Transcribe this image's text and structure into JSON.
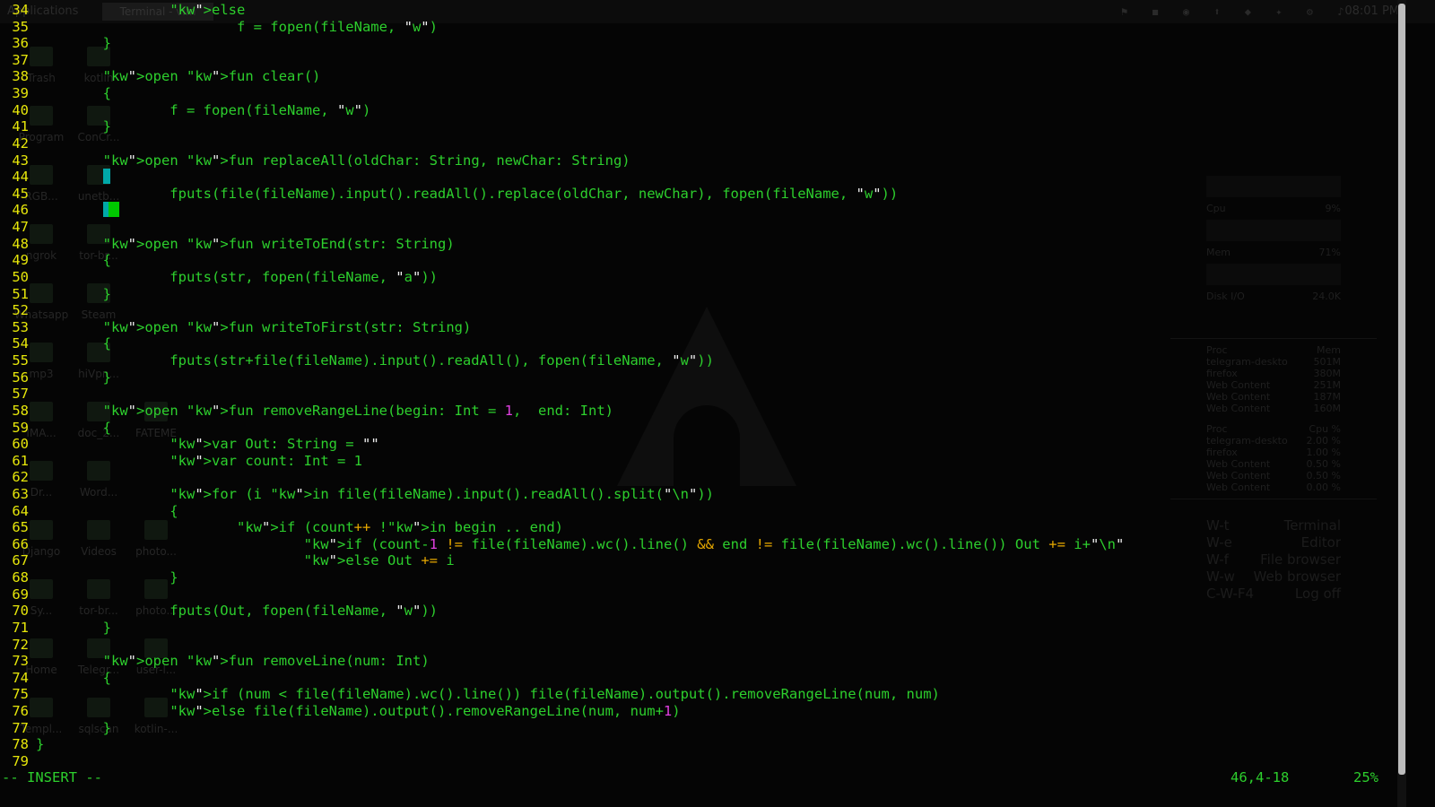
{
  "desktop": {
    "topbar": {
      "apps_menu": "Applications",
      "window_button": "Terminal - vim",
      "clock": "08:01 PM"
    },
    "icons": [
      {
        "label": "Trash"
      },
      {
        "label": "kotlin"
      },
      {
        "label": "Program"
      },
      {
        "label": "ConCr..."
      },
      {
        "label": "RGB..."
      },
      {
        "label": "unetb..."
      },
      {
        "label": "ngrok"
      },
      {
        "label": "tor-br..."
      },
      {
        "label": "Whatsapp"
      },
      {
        "label": "Steam"
      },
      {
        "label": "mp3"
      },
      {
        "label": "hiVpn..."
      },
      {
        "label": "IMA..."
      },
      {
        "label": "doc_2..."
      },
      {
        "label": "FATEME"
      },
      {
        "label": "Dr..."
      },
      {
        "label": "Word..."
      },
      {
        "label": "Django"
      },
      {
        "label": "Videos"
      },
      {
        "label": "photo..."
      },
      {
        "label": "Sy..."
      },
      {
        "label": "tor-br..."
      },
      {
        "label": "photo..."
      },
      {
        "label": "Home"
      },
      {
        "label": "Telegr..."
      },
      {
        "label": "user-l..."
      },
      {
        "label": "Templ..."
      },
      {
        "label": "sqlscan"
      },
      {
        "label": "kotlin-..."
      }
    ],
    "conky": {
      "cpu_label": "Cpu",
      "cpu_value": "9%",
      "mem_label": "Mem",
      "mem_value": "71%",
      "disk_label": "Disk I/O",
      "disk_value": "24.0K",
      "proc_mem_header": [
        "Proc",
        "Mem"
      ],
      "proc_mem": [
        [
          "telegram-deskto",
          "501M"
        ],
        [
          "firefox",
          "380M"
        ],
        [
          "Web Content",
          "251M"
        ],
        [
          "Web Content",
          "187M"
        ],
        [
          "Web Content",
          "160M"
        ]
      ],
      "proc_cpu_header": [
        "Proc",
        "Cpu %"
      ],
      "proc_cpu": [
        [
          "telegram-deskto",
          "2.00 %"
        ],
        [
          "firefox",
          "1.00 %"
        ],
        [
          "Web Content",
          "0.50 %"
        ],
        [
          "Web Content",
          "0.50 %"
        ],
        [
          "Web Content",
          "0.00 %"
        ]
      ],
      "shortcuts": [
        [
          "W-t",
          "Terminal"
        ],
        [
          "W-e",
          "Editor"
        ],
        [
          "W-f",
          "File browser"
        ],
        [
          "W-w",
          "Web browser"
        ],
        [
          "C-W-F4",
          "Log off"
        ]
      ]
    }
  },
  "editor": {
    "lines": [
      {
        "n": "34",
        "t": "                else"
      },
      {
        "n": "35",
        "t": "                        f = fopen(fileName, \"w\")"
      },
      {
        "n": "36",
        "t": "        }"
      },
      {
        "n": "37",
        "t": ""
      },
      {
        "n": "38",
        "t": "        open fun clear()"
      },
      {
        "n": "39",
        "t": "        {"
      },
      {
        "n": "40",
        "t": "                f = fopen(fileName, \"w\")"
      },
      {
        "n": "41",
        "t": "        }"
      },
      {
        "n": "42",
        "t": ""
      },
      {
        "n": "43",
        "t": "        open fun replaceAll(oldChar: String, newChar: String)"
      },
      {
        "n": "44",
        "t": ""
      },
      {
        "n": "45",
        "t": "                fputs(file(fileName).input().readAll().replace(oldChar, newChar), fopen(fileName, \"w\"))"
      },
      {
        "n": "46",
        "t": ""
      },
      {
        "n": "47",
        "t": ""
      },
      {
        "n": "48",
        "t": "        open fun writeToEnd(str: String)"
      },
      {
        "n": "49",
        "t": "        {"
      },
      {
        "n": "50",
        "t": "                fputs(str, fopen(fileName, \"a\"))"
      },
      {
        "n": "51",
        "t": "        }"
      },
      {
        "n": "52",
        "t": ""
      },
      {
        "n": "53",
        "t": "        open fun writeToFirst(str: String)"
      },
      {
        "n": "54",
        "t": "        {"
      },
      {
        "n": "55",
        "t": "                fputs(str+file(fileName).input().readAll(), fopen(fileName, \"w\"))"
      },
      {
        "n": "56",
        "t": "        }"
      },
      {
        "n": "57",
        "t": ""
      },
      {
        "n": "58",
        "t": "        open fun removeRangeLine(begin: Int = 1,  end: Int)"
      },
      {
        "n": "59",
        "t": "        {"
      },
      {
        "n": "60",
        "t": "                var Out: String = \"\""
      },
      {
        "n": "61",
        "t": "                var count: Int = 1"
      },
      {
        "n": "62",
        "t": ""
      },
      {
        "n": "63",
        "t": "                for (i in file(fileName).input().readAll().split(\"\\n\"))"
      },
      {
        "n": "64",
        "t": "                {"
      },
      {
        "n": "65",
        "t": "                        if (count++ !in begin .. end)"
      },
      {
        "n": "66",
        "t": "                                if (count-1 != file(fileName).wc().line() && end != file(fileName).wc().line()) Out += i+\"\\n\""
      },
      {
        "n": "67",
        "t": "                                else Out += i"
      },
      {
        "n": "68",
        "t": "                }"
      },
      {
        "n": "69",
        "t": ""
      },
      {
        "n": "70",
        "t": "                fputs(Out, fopen(fileName, \"w\"))"
      },
      {
        "n": "71",
        "t": "        }"
      },
      {
        "n": "72",
        "t": ""
      },
      {
        "n": "73",
        "t": "        open fun removeLine(num: Int)"
      },
      {
        "n": "74",
        "t": "        {"
      },
      {
        "n": "75",
        "t": "                if (num < file(fileName).wc().line()) file(fileName).output().removeRangeLine(num, num)"
      },
      {
        "n": "76",
        "t": "                else file(fileName).output().removeRangeLine(num, num+1)"
      },
      {
        "n": "77",
        "t": "        }"
      },
      {
        "n": "78",
        "t": "}"
      },
      {
        "n": "79",
        "t": ""
      }
    ],
    "status": {
      "mode": "-- INSERT --",
      "position": "46,4-18",
      "percent": "25%"
    },
    "colors": {
      "line_numbers": "#e6e60a",
      "code": "#2dcf2d",
      "keyword": "#e8e8e8",
      "number_literal": "#e040e0",
      "cursor": "#00a8a8"
    }
  }
}
